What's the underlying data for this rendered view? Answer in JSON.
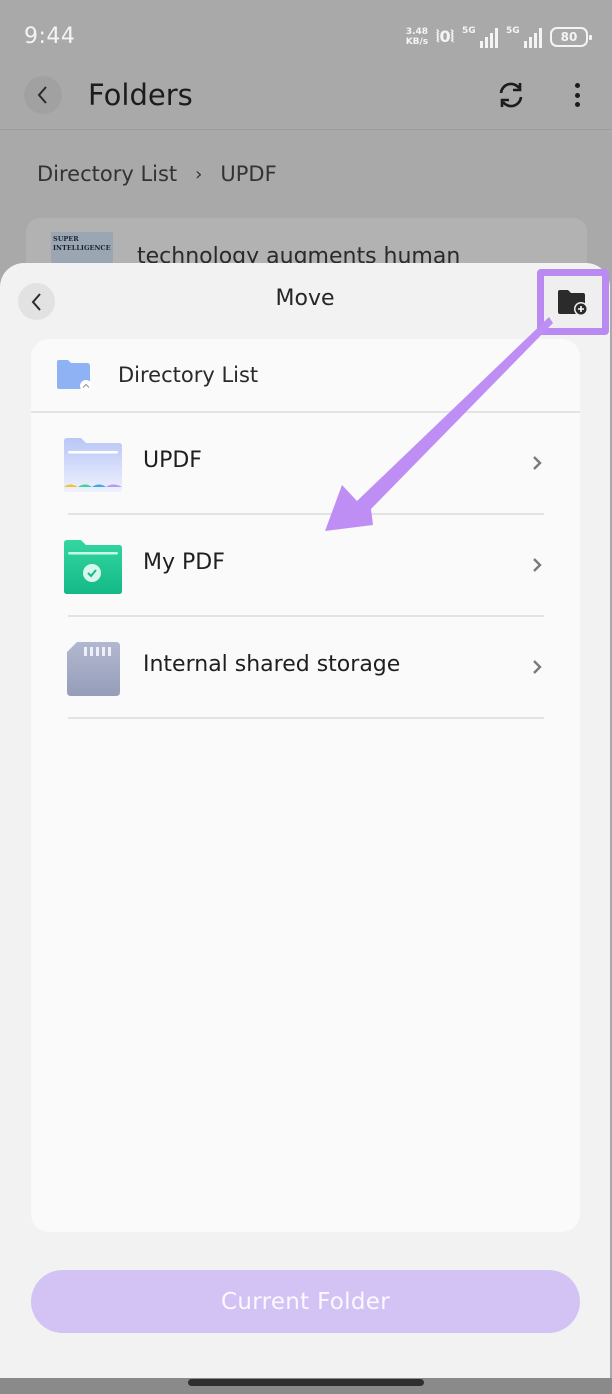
{
  "status_bar": {
    "time": "9:44",
    "net_speed_value": "3.48",
    "net_speed_unit": "KB/s",
    "signal_1_label": "5G",
    "signal_2_label": "5G",
    "battery_level": "80",
    "icons": [
      "vibrate-icon",
      "signal-icon",
      "signal-icon",
      "battery-icon"
    ]
  },
  "app_bar": {
    "title": "Folders",
    "back_icon": "chevron-left-icon",
    "actions": [
      "sync-icon",
      "more-vert-icon"
    ]
  },
  "breadcrumb": {
    "items": [
      "Directory List",
      "UPDF"
    ],
    "separator": "›"
  },
  "background_file": {
    "thumbnail_text": [
      "SUPER",
      "INTELLIGENCE"
    ],
    "name": "technology augments human"
  },
  "move_sheet": {
    "title": "Move",
    "back_icon": "chevron-left-icon",
    "new_folder_icon": "folder-plus-icon",
    "current_location": {
      "label": "Directory List",
      "icon": "folder-up-icon"
    },
    "folders": [
      {
        "label": "UPDF",
        "icon": "updf-folder-icon"
      },
      {
        "label": "My PDF",
        "icon": "green-check-folder-icon"
      },
      {
        "label": "Internal shared storage",
        "icon": "sd-card-icon"
      }
    ],
    "primary_button": "Current Folder"
  },
  "colors": {
    "accent_purple": "#b98bf2",
    "button_disabled": "#d3c3f5",
    "green_folder": "#1fc28e",
    "blue_folder": "#8fb2f5"
  }
}
